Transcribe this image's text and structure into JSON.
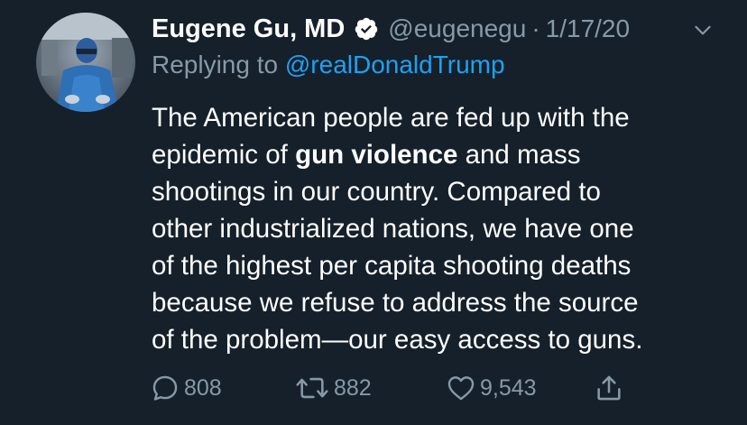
{
  "tweet": {
    "author": {
      "display_name": "Eugene Gu, MD",
      "verified_icon": "verified-badge-icon",
      "handle": "@eugenegu",
      "avatar_icon": "avatar-surgeon-photo"
    },
    "separator": "·",
    "date": "1/17/20",
    "reply": {
      "prefix": "Replying to",
      "mention": "@realDonaldTrump"
    },
    "text_lines": [
      {
        "before": "The American people are fed up with the",
        "bold": "",
        "after": ""
      },
      {
        "before": "epidemic of ",
        "bold": "gun violence",
        "after": " and mass"
      },
      {
        "before": "shootings in our country. Compared to",
        "bold": "",
        "after": ""
      },
      {
        "before": "other industrialized nations, we have one",
        "bold": "",
        "after": ""
      },
      {
        "before": "of the highest per capita shooting deaths",
        "bold": "",
        "after": ""
      },
      {
        "before": "because we refuse to address the source",
        "bold": "",
        "after": ""
      },
      {
        "before": "of the problem—our easy access to guns.",
        "bold": "",
        "after": ""
      }
    ],
    "actions": {
      "replies": "808",
      "retweets": "882",
      "likes": "9,543",
      "reply_icon": "reply-icon",
      "retweet_icon": "retweet-icon",
      "like_icon": "heart-icon",
      "share_icon": "share-icon"
    }
  },
  "colors": {
    "background": "#15202b",
    "text_primary": "#ffffff",
    "text_secondary": "#8899a6",
    "link": "#1da1f2"
  }
}
